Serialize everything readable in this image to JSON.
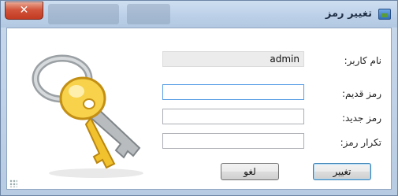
{
  "window": {
    "title": "تغییر رمز",
    "close_symbol": "✕"
  },
  "form": {
    "username": {
      "label": "نام کاربر:",
      "value": "admin"
    },
    "old_password": {
      "label": "رمز قدیم:",
      "value": "",
      "placeholder": ""
    },
    "new_password": {
      "label": "رمز جدید:",
      "value": "",
      "placeholder": ""
    },
    "repeat_password": {
      "label": "تکرار رمز:",
      "value": "",
      "placeholder": ""
    }
  },
  "buttons": {
    "change_label": "تغییر",
    "cancel_label": "لغو"
  },
  "icons": {
    "title": "window-icon",
    "keys": "keys-icon"
  },
  "colors": {
    "titlebar": "#bcd0e8",
    "close": "#c23a21",
    "key_gold": "#f2c12e",
    "key_silver": "#b8bcbf"
  }
}
